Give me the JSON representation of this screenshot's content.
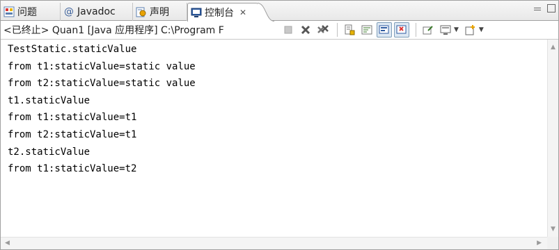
{
  "tabs": [
    {
      "label": "问题",
      "icon": "problems-icon"
    },
    {
      "label": "Javadoc",
      "icon": "javadoc-at-icon"
    },
    {
      "label": "声明",
      "icon": "declaration-icon"
    },
    {
      "label": "控制台",
      "icon": "console-icon",
      "active": true,
      "close": "✕"
    }
  ],
  "toolbar": {
    "process_label": "<已终止> Quan1 [Java 应用程序] C:\\Program F",
    "buttons": [
      "terminate-icon",
      "remove-launch-icon",
      "remove-all-terminated-icon",
      "scroll-lock-icon",
      "word-wrap-icon",
      "show-on-stdout-icon",
      "show-on-stderr-icon",
      "pin-console-icon",
      "display-console-icon",
      "open-console-icon"
    ]
  },
  "console": {
    "lines": [
      "TestStatic.staticValue",
      "from t1:staticValue=static value",
      "from t2:staticValue=static value",
      "t1.staticValue",
      "from t1:staticValue=t1",
      "from t2:staticValue=t1",
      "t2.staticValue",
      "from t1:staticValue=t2"
    ]
  },
  "colors": {
    "tab_bar_bg": "#ececec",
    "border": "#a0a0a0",
    "console_text": "#000000",
    "pressed_button_bg": "#dde8f3"
  }
}
